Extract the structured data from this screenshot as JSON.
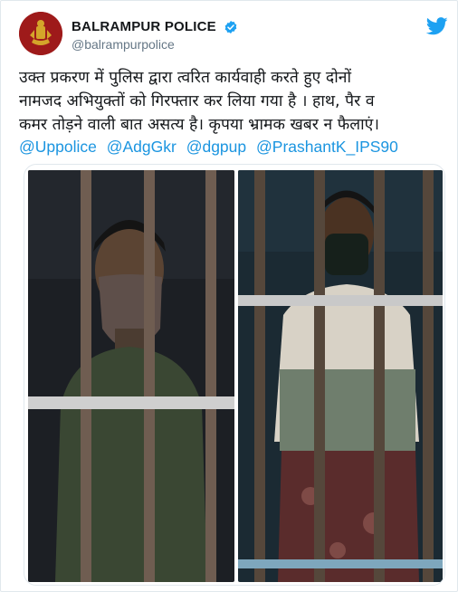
{
  "account": {
    "display_name": "BALRAMPUR POLICE",
    "handle": "@balrampurpolice",
    "verified_icon": "verified-badge-icon",
    "brand_color": "#1da1f2"
  },
  "tweet": {
    "text": "उक्त प्रकरण में पुलिस द्वारा त्वरित कार्यवाही करते हुए दोनों\nनामजद अभियुक्तों को गिरफ्तार कर लिया गया है । हाथ, पैर व\nकमर तोड़ने वाली बात असत्य है। कृपया भ्रामक खबर न फैलाएं।",
    "mentions": [
      "@Uppolice",
      "@AdgGkr",
      "@dgpup",
      "@PrashantK_IPS90"
    ],
    "mention_color": "#1b95e0"
  },
  "media": {
    "photos": [
      "left-photo",
      "right-photo"
    ]
  }
}
